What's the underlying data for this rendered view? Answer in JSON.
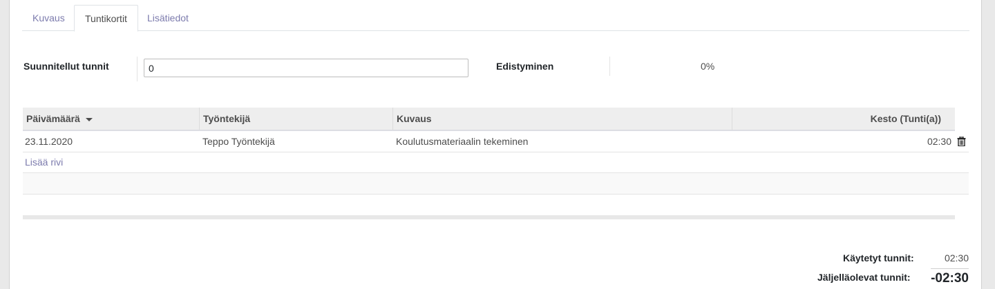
{
  "tabs": [
    {
      "label": "Kuvaus"
    },
    {
      "label": "Tuntikortit"
    },
    {
      "label": "Lisätiedot"
    }
  ],
  "fields": {
    "planned_hours_label": "Suunnitellut tunnit",
    "planned_hours_value": "0",
    "progress_label": "Edistyminen",
    "progress_value": "0%"
  },
  "table": {
    "columns": [
      {
        "label": "Päivämäärä",
        "sort": "descending"
      },
      {
        "label": "Työntekijä"
      },
      {
        "label": "Kuvaus"
      },
      {
        "label": "Kesto (Tunti(a))"
      }
    ],
    "rows": [
      {
        "date": "23.11.2020",
        "employee": "Teppo Työntekijä",
        "description": "Koulutusmateriaalin tekeminen",
        "duration": "02:30"
      }
    ],
    "add_line": "Lisää rivi"
  },
  "totals": {
    "spent_label": "Käytetyt tunnit:",
    "spent_value": "02:30",
    "remaining_label": "Jäljelläolevat tunnit:",
    "remaining_value": "-02:30"
  },
  "colors": {
    "link": "#7c7bad",
    "header_bg": "#eeeeee"
  }
}
